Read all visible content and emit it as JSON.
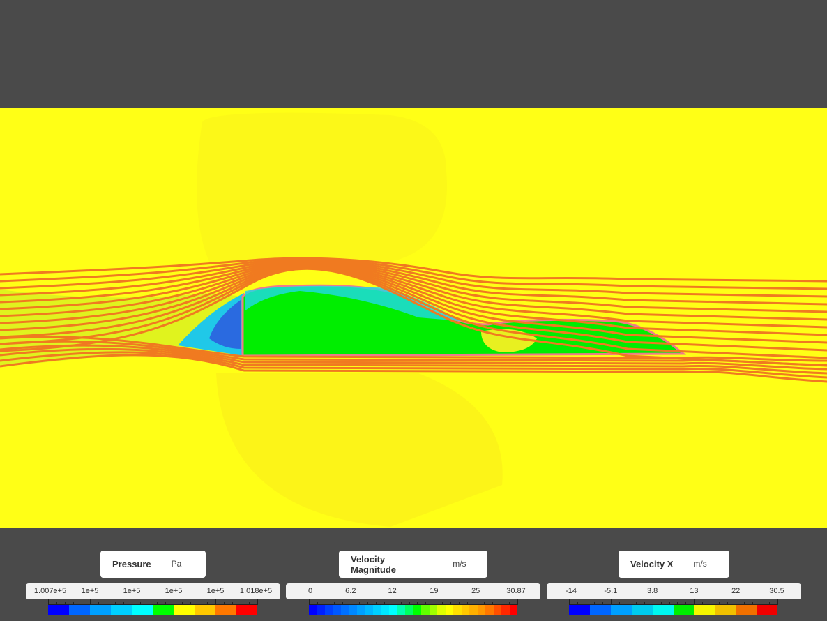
{
  "legends": [
    {
      "id": "pressure",
      "label": "Pressure",
      "unit": "Pa",
      "ticks": [
        "1.007e+5",
        "1e+5",
        "1e+5",
        "1e+5",
        "1e+5",
        "1.018e+5"
      ],
      "colors": [
        "#0000ff",
        "#0066ff",
        "#00a0ff",
        "#00d0ff",
        "#00ffff",
        "#00ff00",
        "#ffff00",
        "#ffc800",
        "#ff7800",
        "#ff0000"
      ]
    },
    {
      "id": "velocity-magnitude",
      "label": "Velocity Magnitude",
      "unit": "m/s",
      "ticks": [
        "0",
        "6.2",
        "12",
        "19",
        "25",
        "30.87"
      ],
      "colors": [
        "#0000ff",
        "#0020ff",
        "#0040ff",
        "#0058ff",
        "#0070ff",
        "#0088ff",
        "#00a0ff",
        "#00b8ff",
        "#00d0ff",
        "#00e8ff",
        "#00ffff",
        "#00ffb0",
        "#00ff60",
        "#00ff00",
        "#60ff00",
        "#a0ff00",
        "#e0ff00",
        "#ffff00",
        "#ffe000",
        "#ffc800",
        "#ffb000",
        "#ff9800",
        "#ff7800",
        "#ff5000",
        "#ff2800",
        "#ff0000"
      ]
    },
    {
      "id": "velocity-x",
      "label": "Velocity X",
      "unit": "m/s",
      "ticks": [
        "-14",
        "-5.1",
        "3.8",
        "13",
        "22",
        "30.5"
      ],
      "colors": [
        "#0000ff",
        "#0066ff",
        "#00a0ff",
        "#00ccee",
        "#00f8f0",
        "#00ee00",
        "#f5f500",
        "#f0c000",
        "#f07000",
        "#f00000"
      ]
    }
  ],
  "colors": {
    "background": "#4a4a4a",
    "field": "#ffff16",
    "interior": "#00ee00",
    "streamline": "#f07a20"
  }
}
